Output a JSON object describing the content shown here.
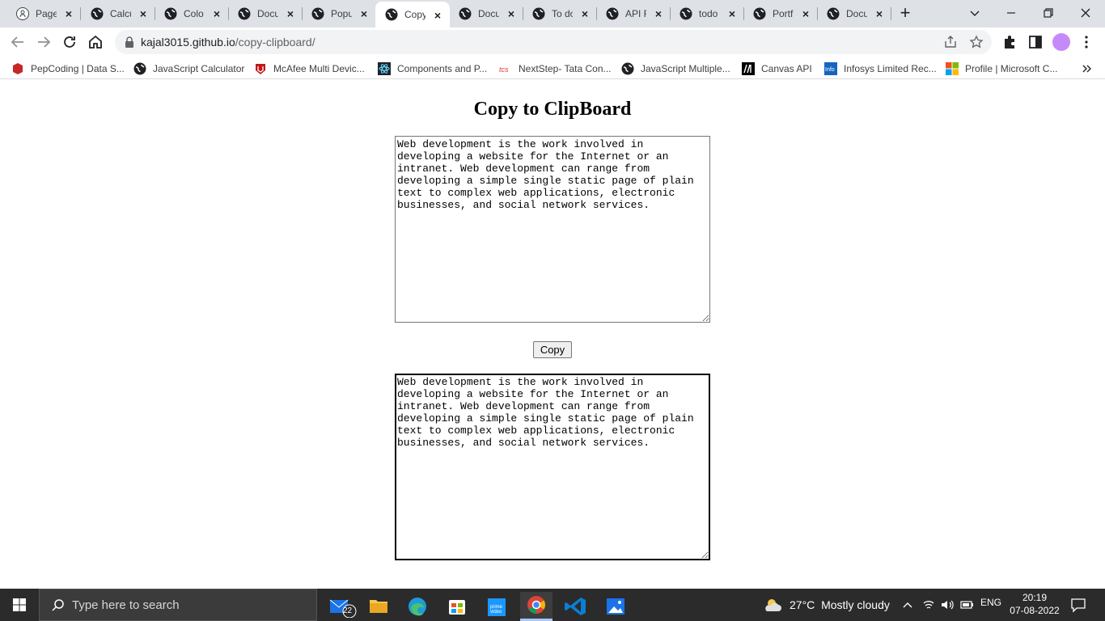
{
  "browser": {
    "tabs": [
      {
        "title": "Page",
        "icon": "github-icon"
      },
      {
        "title": "Calcu",
        "icon": "globe-icon"
      },
      {
        "title": "Colo",
        "icon": "globe-icon"
      },
      {
        "title": "Docu",
        "icon": "globe-icon"
      },
      {
        "title": "Popu",
        "icon": "globe-icon"
      },
      {
        "title": "Copy",
        "icon": "globe-icon",
        "active": true
      },
      {
        "title": "Docu",
        "icon": "globe-icon"
      },
      {
        "title": "To do",
        "icon": "globe-icon"
      },
      {
        "title": "API F",
        "icon": "globe-icon"
      },
      {
        "title": "todo",
        "icon": "globe-icon"
      },
      {
        "title": "Portf",
        "icon": "globe-icon"
      },
      {
        "title": "Docu",
        "icon": "globe-icon"
      }
    ],
    "url_host": "kajal3015.github.io",
    "url_path": "/copy-clipboard/",
    "bookmarks": [
      {
        "label": "PepCoding | Data S...",
        "icon": "pepcoding-icon"
      },
      {
        "label": "JavaScript Calculator",
        "icon": "globe-icon"
      },
      {
        "label": "McAfee Multi Devic...",
        "icon": "mcafee-icon"
      },
      {
        "label": "Components and P...",
        "icon": "react-icon"
      },
      {
        "label": "NextStep- Tata Con...",
        "icon": "tcs-icon"
      },
      {
        "label": "JavaScript Multiple...",
        "icon": "globe-icon"
      },
      {
        "label": "Canvas API",
        "icon": "mdn-icon"
      },
      {
        "label": "Infosys Limited Rec...",
        "icon": "infosys-icon"
      },
      {
        "label": "Profile | Microsoft C...",
        "icon": "microsoft-icon"
      }
    ]
  },
  "page": {
    "title": "Copy to ClipBoard",
    "source_text": "Web development is the work involved in developing a website for the Internet or an intranet. Web development can range from developing a simple single static page of plain text to complex web applications, electronic businesses, and social network services.",
    "copy_button": "Copy",
    "target_text": "Web development is the work involved in developing a website for the Internet or an intranet. Web development can range from developing a simple single static page of plain text to complex web applications, electronic businesses, and social network services."
  },
  "taskbar": {
    "search_placeholder": "Type here to search",
    "mail_badge": "22",
    "weather_temp": "27°C",
    "weather_text": "Mostly cloudy",
    "language": "ENG",
    "time": "20:19",
    "date": "07-08-2022"
  },
  "colors": {
    "tabstrip": "#dee1e6",
    "omnibox": "#f1f3f4",
    "taskbar": "#2b2b2b"
  }
}
